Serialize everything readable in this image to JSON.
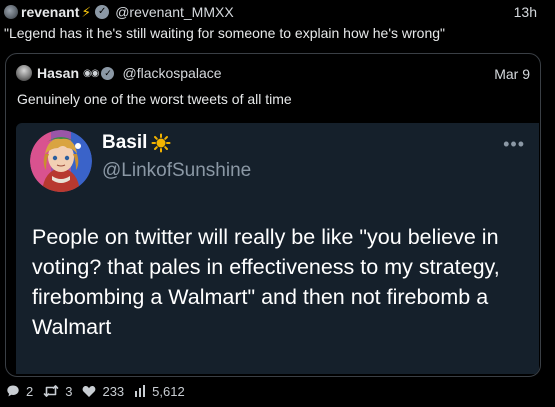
{
  "outer": {
    "display_name": "revenant",
    "handle": "@revenant_MMXX",
    "time": "13h",
    "text": "\"Legend has it he's still waiting for someone to explain how he's wrong\""
  },
  "quote": {
    "display_name": "Hasan",
    "handle": "@flackospalace",
    "date": "Mar 9",
    "text": "Genuinely one of the worst tweets of all time"
  },
  "inner": {
    "display_name": "Basil",
    "handle": "@LinkofSunshine",
    "text": "People on twitter will really be like \"you believe in voting? that pales in effectiveness to my strategy, firebombing a Walmart\" and then not firebomb a Walmart"
  },
  "actions": {
    "replies": "2",
    "retweets": "3",
    "likes": "233",
    "views": "5,612"
  },
  "colors": {
    "background": "#000000",
    "inner_card": "#15202b",
    "text": "#e7e9ea",
    "muted": "#8b98a5",
    "bolt": "#f4c20d",
    "sun": "#f4b400"
  }
}
